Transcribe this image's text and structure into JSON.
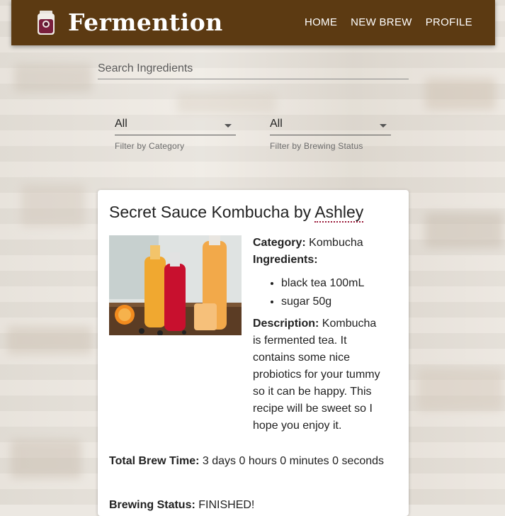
{
  "header": {
    "brand": "Fermention",
    "nav": [
      "HOME",
      "NEW BREW",
      "PROFILE"
    ]
  },
  "search": {
    "placeholder": "Search Ingredients"
  },
  "filters": {
    "category": {
      "value": "All",
      "helper": "Filter by Category"
    },
    "status": {
      "value": "All",
      "helper": "Filter by Brewing Status"
    }
  },
  "card": {
    "title": "Secret Sauce Kombucha by",
    "author": "Ashley",
    "category_label": "Category:",
    "category": "Kombucha",
    "ingredients_label": "Ingredients:",
    "ingredients": [
      "black tea 100mL",
      "sugar 50g"
    ],
    "description_label": "Description:",
    "description": "Kombucha is fermented tea. It contains some nice probiotics for your tummy so it can be happy. This recipe will be sweet so I hope you enjoy it.",
    "brew_time_label": "Total Brew Time:",
    "brew_time": "3 days 0 hours 0 minutes 0 seconds",
    "status_label": "Brewing Status:",
    "status": "FINISHED!"
  },
  "colors": {
    "header": "#5c3a12",
    "author_underline": "#9b1b3a"
  }
}
